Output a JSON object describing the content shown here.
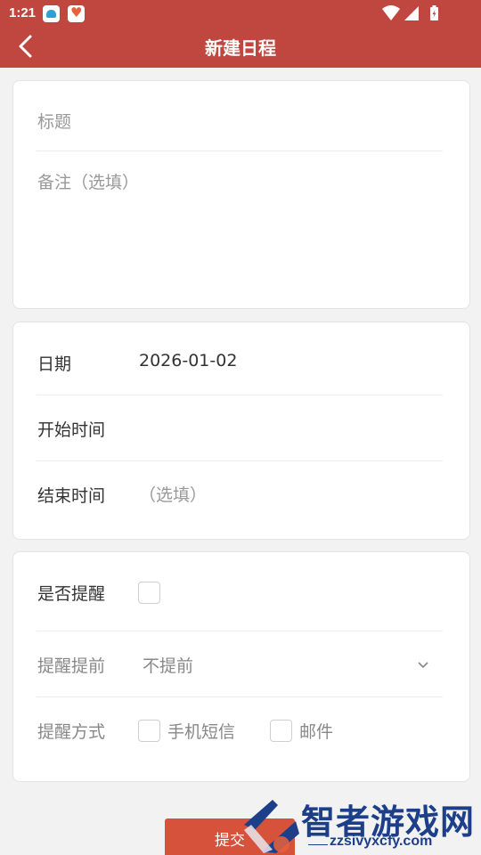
{
  "status_bar": {
    "time": "1:21",
    "icons": [
      "app-icon-1",
      "app-icon-2",
      "wifi-icon",
      "signal-icon",
      "battery-icon"
    ]
  },
  "app_bar": {
    "title": "新建日程",
    "back_icon": "chevron-left-icon"
  },
  "event_form": {
    "title_placeholder": "标题",
    "notes_placeholder": "备注（选填）"
  },
  "time_section": {
    "date_label": "日期",
    "date_value": "2026-01-02",
    "start_time_label": "开始时间",
    "start_time_value": "",
    "end_time_label": "结束时间",
    "end_time_placeholder": "（选填）"
  },
  "reminder_section": {
    "remind_label": "是否提醒",
    "remind_checked": false,
    "advance_label": "提醒提前",
    "advance_value": "不提前",
    "method_label": "提醒方式",
    "methods": [
      {
        "label": "手机短信",
        "checked": false
      },
      {
        "label": "邮件",
        "checked": false
      }
    ]
  },
  "submit_label": "提交",
  "watermark": {
    "name": "智者游戏网",
    "url": "zzsivyxcfy.com"
  },
  "colors": {
    "primary": "#c0473f",
    "button": "#d6523a",
    "background": "#f2f2f2"
  }
}
